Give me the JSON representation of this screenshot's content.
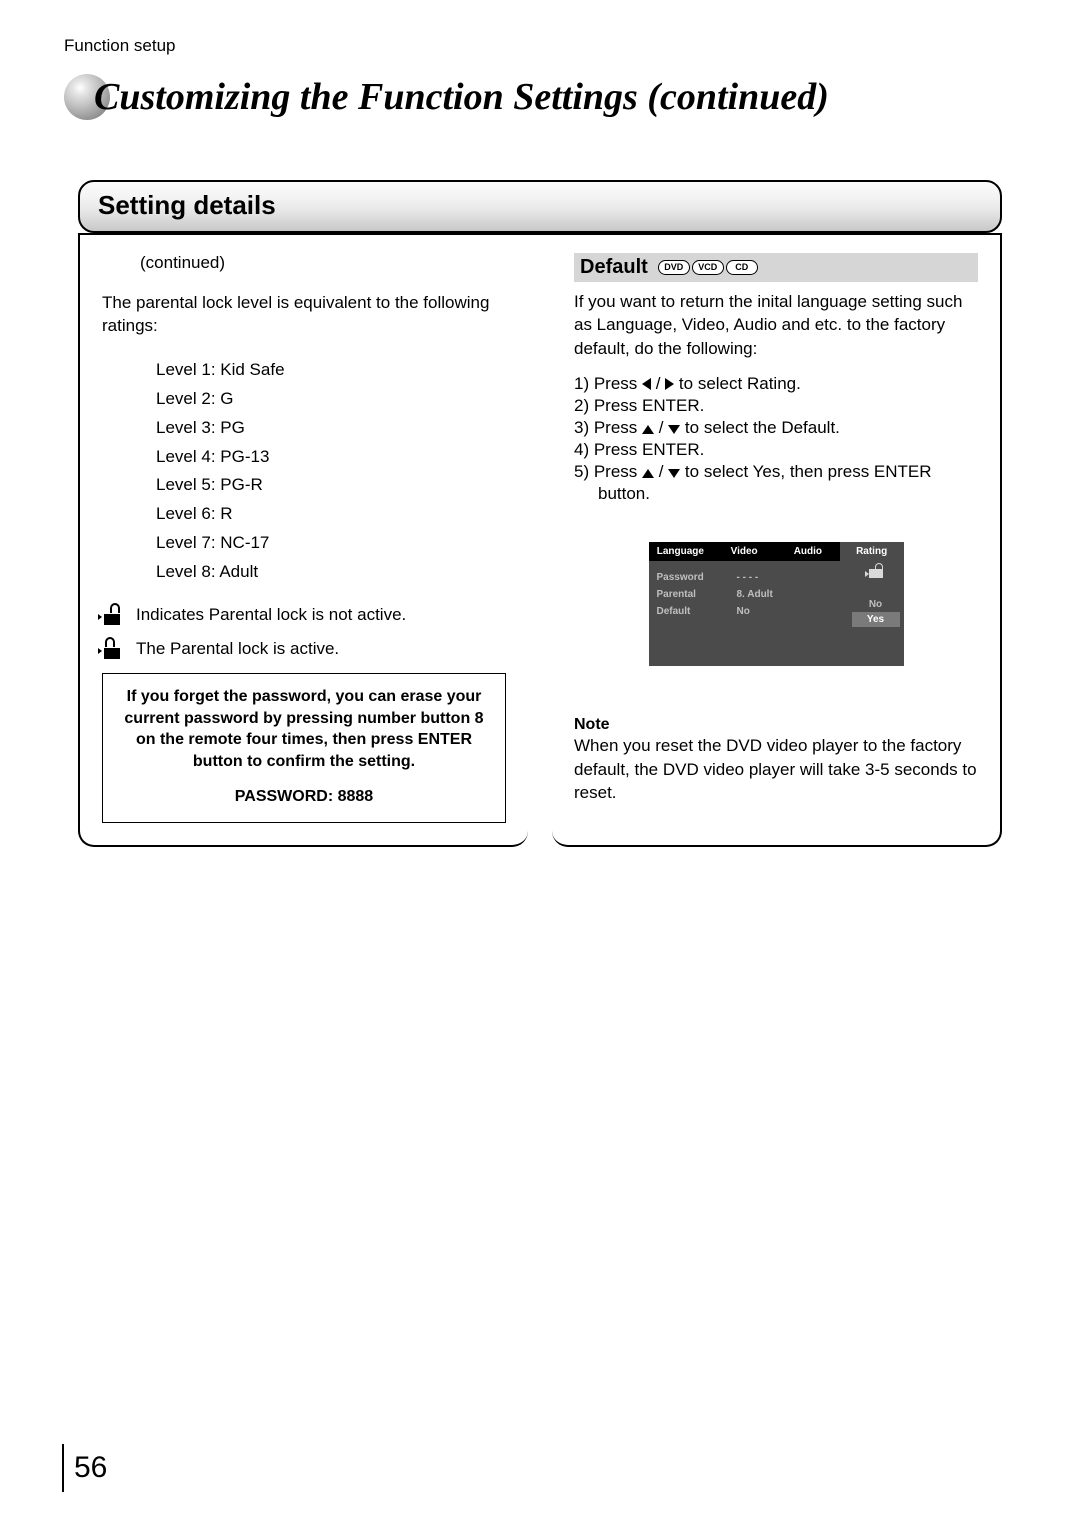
{
  "header": {
    "section_label": "Function setup",
    "page_title": "Customizing the Function Settings (continued)"
  },
  "setting_details": {
    "box_title": "Setting details"
  },
  "left": {
    "continued": "(continued)",
    "intro": "The parental lock level is equivalent to the following ratings:",
    "levels": {
      "l1": "Level 1: Kid Safe",
      "l2": "Level 2: G",
      "l3": "Level 3: PG",
      "l4": "Level 4: PG-13",
      "l5": "Level 5: PG-R",
      "l6": "Level 6: R",
      "l7": "Level 7: NC-17",
      "l8": "Level 8: Adult"
    },
    "lock_inactive": "Indicates Parental lock is not active.",
    "lock_active": "The Parental lock is active.",
    "pw_box": {
      "line": "If you forget the password, you can erase your current password by pressing number button 8 on the remote four times, then press ENTER button to confirm the setting.",
      "code": "PASSWORD: 8888"
    }
  },
  "right": {
    "heading": "Default",
    "discs": {
      "d1": "DVD",
      "d2": "VCD",
      "d3": "CD"
    },
    "intro": "If you want to return the inital language setting such as Language, Video, Audio and etc. to the factory default, do the following:",
    "steps": {
      "s1a": "1)  Press ",
      "s1b": " / ",
      "s1c": " to select Rating.",
      "s2": "2)  Press ENTER.",
      "s3a": "3)  Press ",
      "s3b": " / ",
      "s3c": " to select the Default.",
      "s4": "4)  Press ENTER.",
      "s5a": "5)  Press ",
      "s5b": " / ",
      "s5c": " to select Yes, then press ENTER",
      "s5d": "button."
    },
    "osd": {
      "tabs": {
        "t1": "Language",
        "t2": "Video",
        "t3": "Audio",
        "t4": "Rating"
      },
      "rows": {
        "password_l": "Password",
        "password_v": "- - - -",
        "parental_l": "Parental",
        "parental_v": "8. Adult",
        "default_l": "Default",
        "default_v": "No"
      },
      "options": {
        "no": "No",
        "yes": "Yes"
      }
    },
    "note": {
      "h": "Note",
      "t": "When you reset the DVD video player to the factory default, the DVD video player will take 3-5 seconds to reset."
    }
  },
  "page_number": "56"
}
